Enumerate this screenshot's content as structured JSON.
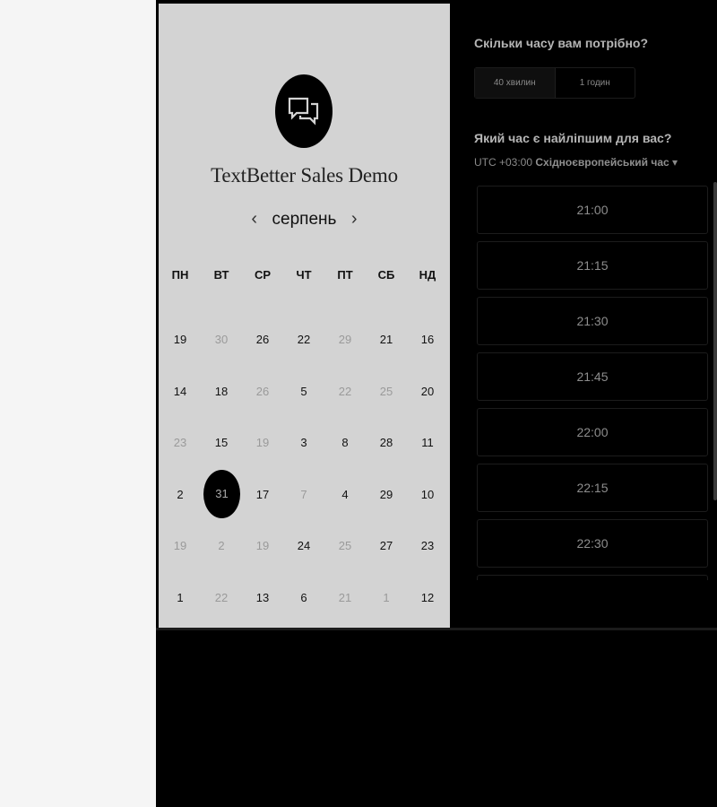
{
  "scheduler": {
    "title": "TextBetter Sales Demo",
    "month": "серпень",
    "prev_icon": "chevron-left-icon",
    "next_icon": "chevron-right-icon",
    "logo_icon": "chat-bubbles-icon",
    "weekdays": [
      "ПН",
      "ВТ",
      "СР",
      "ЧТ",
      "ПТ",
      "СБ",
      "НД"
    ],
    "weeks": [
      [
        {
          "d": "19",
          "m": false
        },
        {
          "d": "30",
          "m": true
        },
        {
          "d": "26",
          "m": false
        },
        {
          "d": "22",
          "m": false
        },
        {
          "d": "29",
          "m": true
        },
        {
          "d": "21",
          "m": false
        },
        {
          "d": "16",
          "m": false
        }
      ],
      [
        {
          "d": "14",
          "m": false
        },
        {
          "d": "18",
          "m": false
        },
        {
          "d": "26",
          "m": true
        },
        {
          "d": "5",
          "m": false
        },
        {
          "d": "22",
          "m": true
        },
        {
          "d": "25",
          "m": true
        },
        {
          "d": "20",
          "m": false
        }
      ],
      [
        {
          "d": "23",
          "m": true
        },
        {
          "d": "15",
          "m": false
        },
        {
          "d": "19",
          "m": true
        },
        {
          "d": "3",
          "m": false
        },
        {
          "d": "8",
          "m": false
        },
        {
          "d": "28",
          "m": false
        },
        {
          "d": "11",
          "m": false
        }
      ],
      [
        {
          "d": "2",
          "m": false
        },
        {
          "d": "31",
          "m": false,
          "selected": true
        },
        {
          "d": "17",
          "m": false
        },
        {
          "d": "7",
          "m": true
        },
        {
          "d": "4",
          "m": false
        },
        {
          "d": "29",
          "m": false
        },
        {
          "d": "10",
          "m": false
        }
      ],
      [
        {
          "d": "19",
          "m": true
        },
        {
          "d": "2",
          "m": true
        },
        {
          "d": "19",
          "m": true
        },
        {
          "d": "24",
          "m": false
        },
        {
          "d": "25",
          "m": true
        },
        {
          "d": "27",
          "m": false
        },
        {
          "d": "23",
          "m": false
        }
      ],
      [
        {
          "d": "1",
          "m": false
        },
        {
          "d": "22",
          "m": true
        },
        {
          "d": "13",
          "m": false
        },
        {
          "d": "6",
          "m": false
        },
        {
          "d": "21",
          "m": true
        },
        {
          "d": "1",
          "m": true
        },
        {
          "d": "12",
          "m": false
        }
      ]
    ]
  },
  "booking": {
    "duration_question": "Скільки часу вам потрібно?",
    "durations": [
      {
        "label": "40 хвилин",
        "active": true
      },
      {
        "label": "1 годин",
        "active": false
      }
    ],
    "time_question": "Який час є найліпшим для вас?",
    "tz_offset": "UTC +03:00",
    "tz_name": "Східноєвропейський час",
    "tz_caret": "▾",
    "slots": [
      "21:00",
      "21:15",
      "21:30",
      "21:45",
      "22:00",
      "22:15",
      "22:30",
      ""
    ]
  },
  "colors": {
    "panel": "#d3d3d3",
    "background": "#000000",
    "side": "#f5f5f5"
  }
}
